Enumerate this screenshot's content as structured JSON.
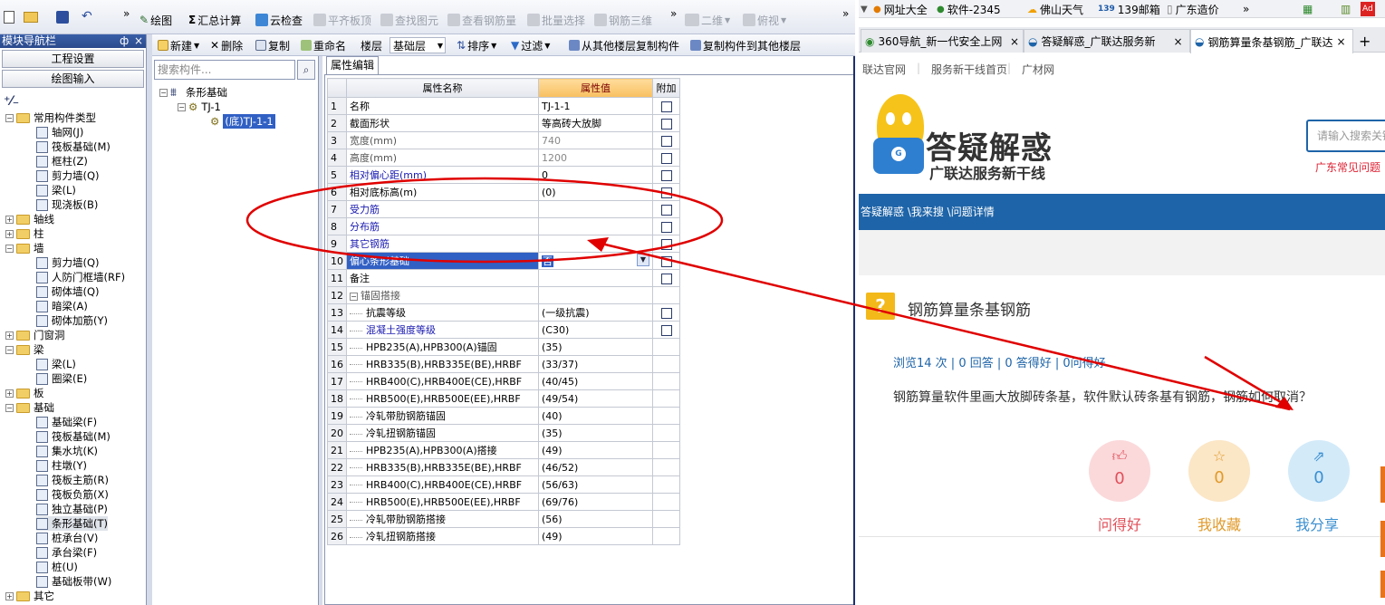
{
  "toolbar": {
    "draw": "绘图",
    "summary": "汇总计算",
    "cloud_check": "云检查",
    "level_slab": "平齐板顶",
    "find_element": "查找图元",
    "view_rebar": "查看钢筋量",
    "batch_select": "批量选择",
    "rebar_3d": "钢筋三维",
    "view_mode": "二维",
    "view_angle": "俯视"
  },
  "toolbar2": {
    "new": "新建",
    "delete": "删除",
    "copy": "复制",
    "rename": "重命名",
    "floor_label": "楼层",
    "floor_value": "基础层",
    "sort": "排序",
    "filter": "过滤",
    "copy_from_floor": "从其他楼层复制构件",
    "copy_to_floor": "复制构件到其他楼层"
  },
  "nav": {
    "title": "模块导航栏",
    "pin": "ф",
    "close": "×",
    "btn_project": "工程设置",
    "btn_draw": "绘图输入",
    "tree": [
      "常用构件类型",
      "轴网(J)",
      "筏板基础(M)",
      "框柱(Z)",
      "剪力墙(Q)",
      "梁(L)",
      "现浇板(B)",
      "轴线",
      "柱",
      "墙",
      "剪力墙(Q)",
      "人防门框墙(RF)",
      "砌体墙(Q)",
      "暗梁(A)",
      "砌体加筋(Y)",
      "门窗洞",
      "梁",
      "梁(L)",
      "圈梁(E)",
      "板",
      "基础",
      "基础梁(F)",
      "筏板基础(M)",
      "集水坑(K)",
      "柱墩(Y)",
      "筏板主筋(R)",
      "筏板负筋(X)",
      "独立基础(P)",
      "条形基础(T)",
      "桩承台(V)",
      "承台梁(F)",
      "桩(U)",
      "基础板带(W)",
      "其它"
    ]
  },
  "component_tree": {
    "search_placeholder": "搜索构件...",
    "root": "条形基础",
    "child": "TJ-1",
    "leaf": "(底)TJ-1-1"
  },
  "props": {
    "tab": "属性编辑",
    "col_name": "属性名称",
    "col_value": "属性值",
    "col_add": "附加",
    "rows": [
      {
        "n": "1",
        "name": "名称",
        "value": "TJ-1-1"
      },
      {
        "n": "2",
        "name": "截面形状",
        "value": "等高砖大放脚"
      },
      {
        "n": "3",
        "name": "宽度(mm)",
        "value": "740"
      },
      {
        "n": "4",
        "name": "高度(mm)",
        "value": "1200"
      },
      {
        "n": "5",
        "name": "相对偏心距(mm)",
        "value": "0"
      },
      {
        "n": "6",
        "name": "相对底标高(m)",
        "value": "(0)"
      },
      {
        "n": "7",
        "name": "受力筋",
        "value": ""
      },
      {
        "n": "8",
        "name": "分布筋",
        "value": ""
      },
      {
        "n": "9",
        "name": "其它钢筋",
        "value": ""
      },
      {
        "n": "10",
        "name": "偏心条形基础",
        "value": "否"
      },
      {
        "n": "11",
        "name": "备注",
        "value": ""
      },
      {
        "n": "12",
        "name": "锚固搭接",
        "value": ""
      },
      {
        "n": "13",
        "name": "抗震等级",
        "value": "(一级抗震)"
      },
      {
        "n": "14",
        "name": "混凝土强度等级",
        "value": "(C30)"
      },
      {
        "n": "15",
        "name": "HPB235(A),HPB300(A)锚固",
        "value": "(35)"
      },
      {
        "n": "16",
        "name": "HRB335(B),HRB335E(BE),HRBF",
        "value": "(33/37)"
      },
      {
        "n": "17",
        "name": "HRB400(C),HRB400E(CE),HRBF",
        "value": "(40/45)"
      },
      {
        "n": "18",
        "name": "HRB500(E),HRB500E(EE),HRBF",
        "value": "(49/54)"
      },
      {
        "n": "19",
        "name": "冷轧带肋钢筋锚固",
        "value": "(40)"
      },
      {
        "n": "20",
        "name": "冷轧扭钢筋锚固",
        "value": "(35)"
      },
      {
        "n": "21",
        "name": "HPB235(A),HPB300(A)搭接",
        "value": "(49)"
      },
      {
        "n": "22",
        "name": "HRB335(B),HRB335E(BE),HRBF",
        "value": "(46/52)"
      },
      {
        "n": "23",
        "name": "HRB400(C),HRB400E(CE),HRBF",
        "value": "(56/63)"
      },
      {
        "n": "24",
        "name": "HRB500(E),HRB500E(EE),HRBF",
        "value": "(69/76)"
      },
      {
        "n": "25",
        "name": "冷轧带肋钢筋搭接",
        "value": "(56)"
      },
      {
        "n": "26",
        "name": "冷轧扭钢筋搭接",
        "value": "(49)"
      }
    ]
  },
  "browser": {
    "bookmarks": [
      "网址大全",
      "软件-2345",
      "佛山天气",
      "139邮箱",
      "广东造价"
    ],
    "more": "»",
    "tabs": [
      "360导航_新一代安全上网",
      "答疑解惑_广联达服务新",
      "钢筋算量条基钢筋_广联达"
    ],
    "new_tab": "+",
    "top_links": [
      "联达官网",
      "服务新干线首页",
      "广材网"
    ],
    "logo_title": "答疑解惑",
    "logo_sub": "广联达服务新干线",
    "search_placeholder": "请输入搜索关键",
    "common_q": "广东常见问题",
    "breadcrumb": "答疑解惑 \\我来搜 \\问题详情",
    "question_title": "钢筋算量条基钢筋",
    "stats": "浏览14 次 | 0 回答 | 0 答得好 | 0问得好",
    "question_body": "钢筋算量软件里画大放脚砖条基，软件默认砖条基有钢筋，钢筋如何取消？",
    "actions": [
      {
        "label": "问得好",
        "count": "0",
        "color": "#e0505a",
        "bg": "#fbd9db"
      },
      {
        "label": "我收藏",
        "count": "0",
        "color": "#e09a2a",
        "bg": "#fbe6c6"
      },
      {
        "label": "我分享",
        "count": "0",
        "color": "#3a8fd0",
        "bg": "#d3eaf9"
      }
    ]
  },
  "colors": {
    "annotation_red": "#e00000",
    "selected_row": "#3160c4",
    "browser_bar": "#1e64a8"
  }
}
